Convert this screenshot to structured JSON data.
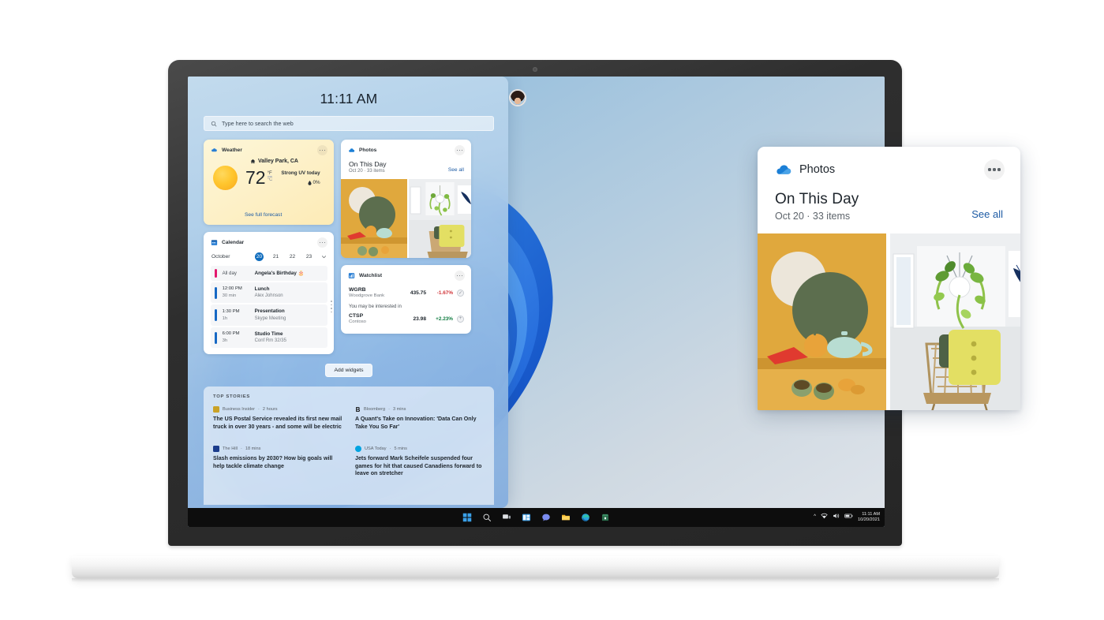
{
  "device": {
    "name": "laptop-mockup"
  },
  "widgets_board": {
    "clock": "11:11 AM",
    "avatar_name": "user-avatar",
    "search": {
      "placeholder": "Type here to search the web",
      "value": ""
    },
    "add_widgets_label": "Add widgets",
    "weather": {
      "title": "Weather",
      "location": "Valley Park, CA",
      "temperature": "72",
      "unit_primary": "°F",
      "unit_secondary": "°C",
      "condition": "Strong UV today",
      "precipitation": "0%",
      "link": "See full forecast"
    },
    "calendar": {
      "title": "Calendar",
      "month": "October",
      "days": [
        "20",
        "21",
        "22",
        "23"
      ],
      "selected_day": "20",
      "events": [
        {
          "time": "All day",
          "duration": "",
          "title": "Angela's Birthday 🎂",
          "subtitle": ""
        },
        {
          "time": "12:00 PM",
          "duration": "30 min",
          "title": "Lunch",
          "subtitle": "Alex Johnson"
        },
        {
          "time": "1:30 PM",
          "duration": "1h",
          "title": "Presentation",
          "subtitle": "Skype Meeting"
        },
        {
          "time": "6:00 PM",
          "duration": "3h",
          "title": "Studio Time",
          "subtitle": "Conf Rm 32/35"
        }
      ]
    },
    "photos": {
      "title": "Photos",
      "heading": "On This Day",
      "subheading": "Oct 20 · 33 items",
      "see_all": "See all"
    },
    "watchlist": {
      "title": "Watchlist",
      "rows": [
        {
          "symbol": "WGRB",
          "company": "Woodgrove Bank",
          "price": "435.75",
          "change": "-1.67%",
          "direction": "down",
          "action": "checked"
        },
        {
          "symbol": "CTSP",
          "company": "Contoso",
          "price": "23.98",
          "change": "+2.23%",
          "direction": "up",
          "action": "add"
        }
      ],
      "note": "You may be interested in"
    },
    "news": {
      "section_label": "TOP STORIES",
      "articles": [
        {
          "source": "Business Insider",
          "time": "2 hours",
          "headline": "The US Postal Service revealed its first new mail truck in over 30 years - and some will be electric",
          "badge": "▬",
          "badge_color": "#c9a227"
        },
        {
          "source": "Bloomberg",
          "time": "3 mins",
          "headline": "A Quant's Take on Innovation: 'Data Can Only Take You So Far'",
          "badge": "B",
          "badge_color": "#111111"
        },
        {
          "source": "The Hill",
          "time": "18 mins",
          "headline": "Slash emissions by 2030? How big goals will help tackle climate change",
          "badge": "▥",
          "badge_color": "#1b3c8c"
        },
        {
          "source": "USA Today",
          "time": "5 mins",
          "headline": "Jets forward Mark Scheifele suspended four games for hit that caused Canadiens forward to leave on stretcher",
          "badge": "●",
          "badge_color": "#00a3e0"
        }
      ]
    }
  },
  "callout": {
    "app_title": "Photos",
    "heading": "On This Day",
    "subheading": "Oct 20 · 33 items",
    "see_all": "See all"
  },
  "taskbar": {
    "icons": [
      "start-icon",
      "search-icon",
      "task-view-icon",
      "widgets-icon",
      "chat-icon",
      "file-explorer-icon",
      "edge-icon",
      "store-icon"
    ],
    "tray": {
      "chevron": "^",
      "network": "network-icon",
      "volume": "volume-icon",
      "battery": "battery-icon",
      "time": "11:11 AM",
      "date": "10/20/2021"
    }
  },
  "colors": {
    "accent": "#0f6cbd",
    "link": "#1d5ba4",
    "down": "#d13438",
    "up": "#107c41",
    "taskbar": "#0d0d0d"
  }
}
